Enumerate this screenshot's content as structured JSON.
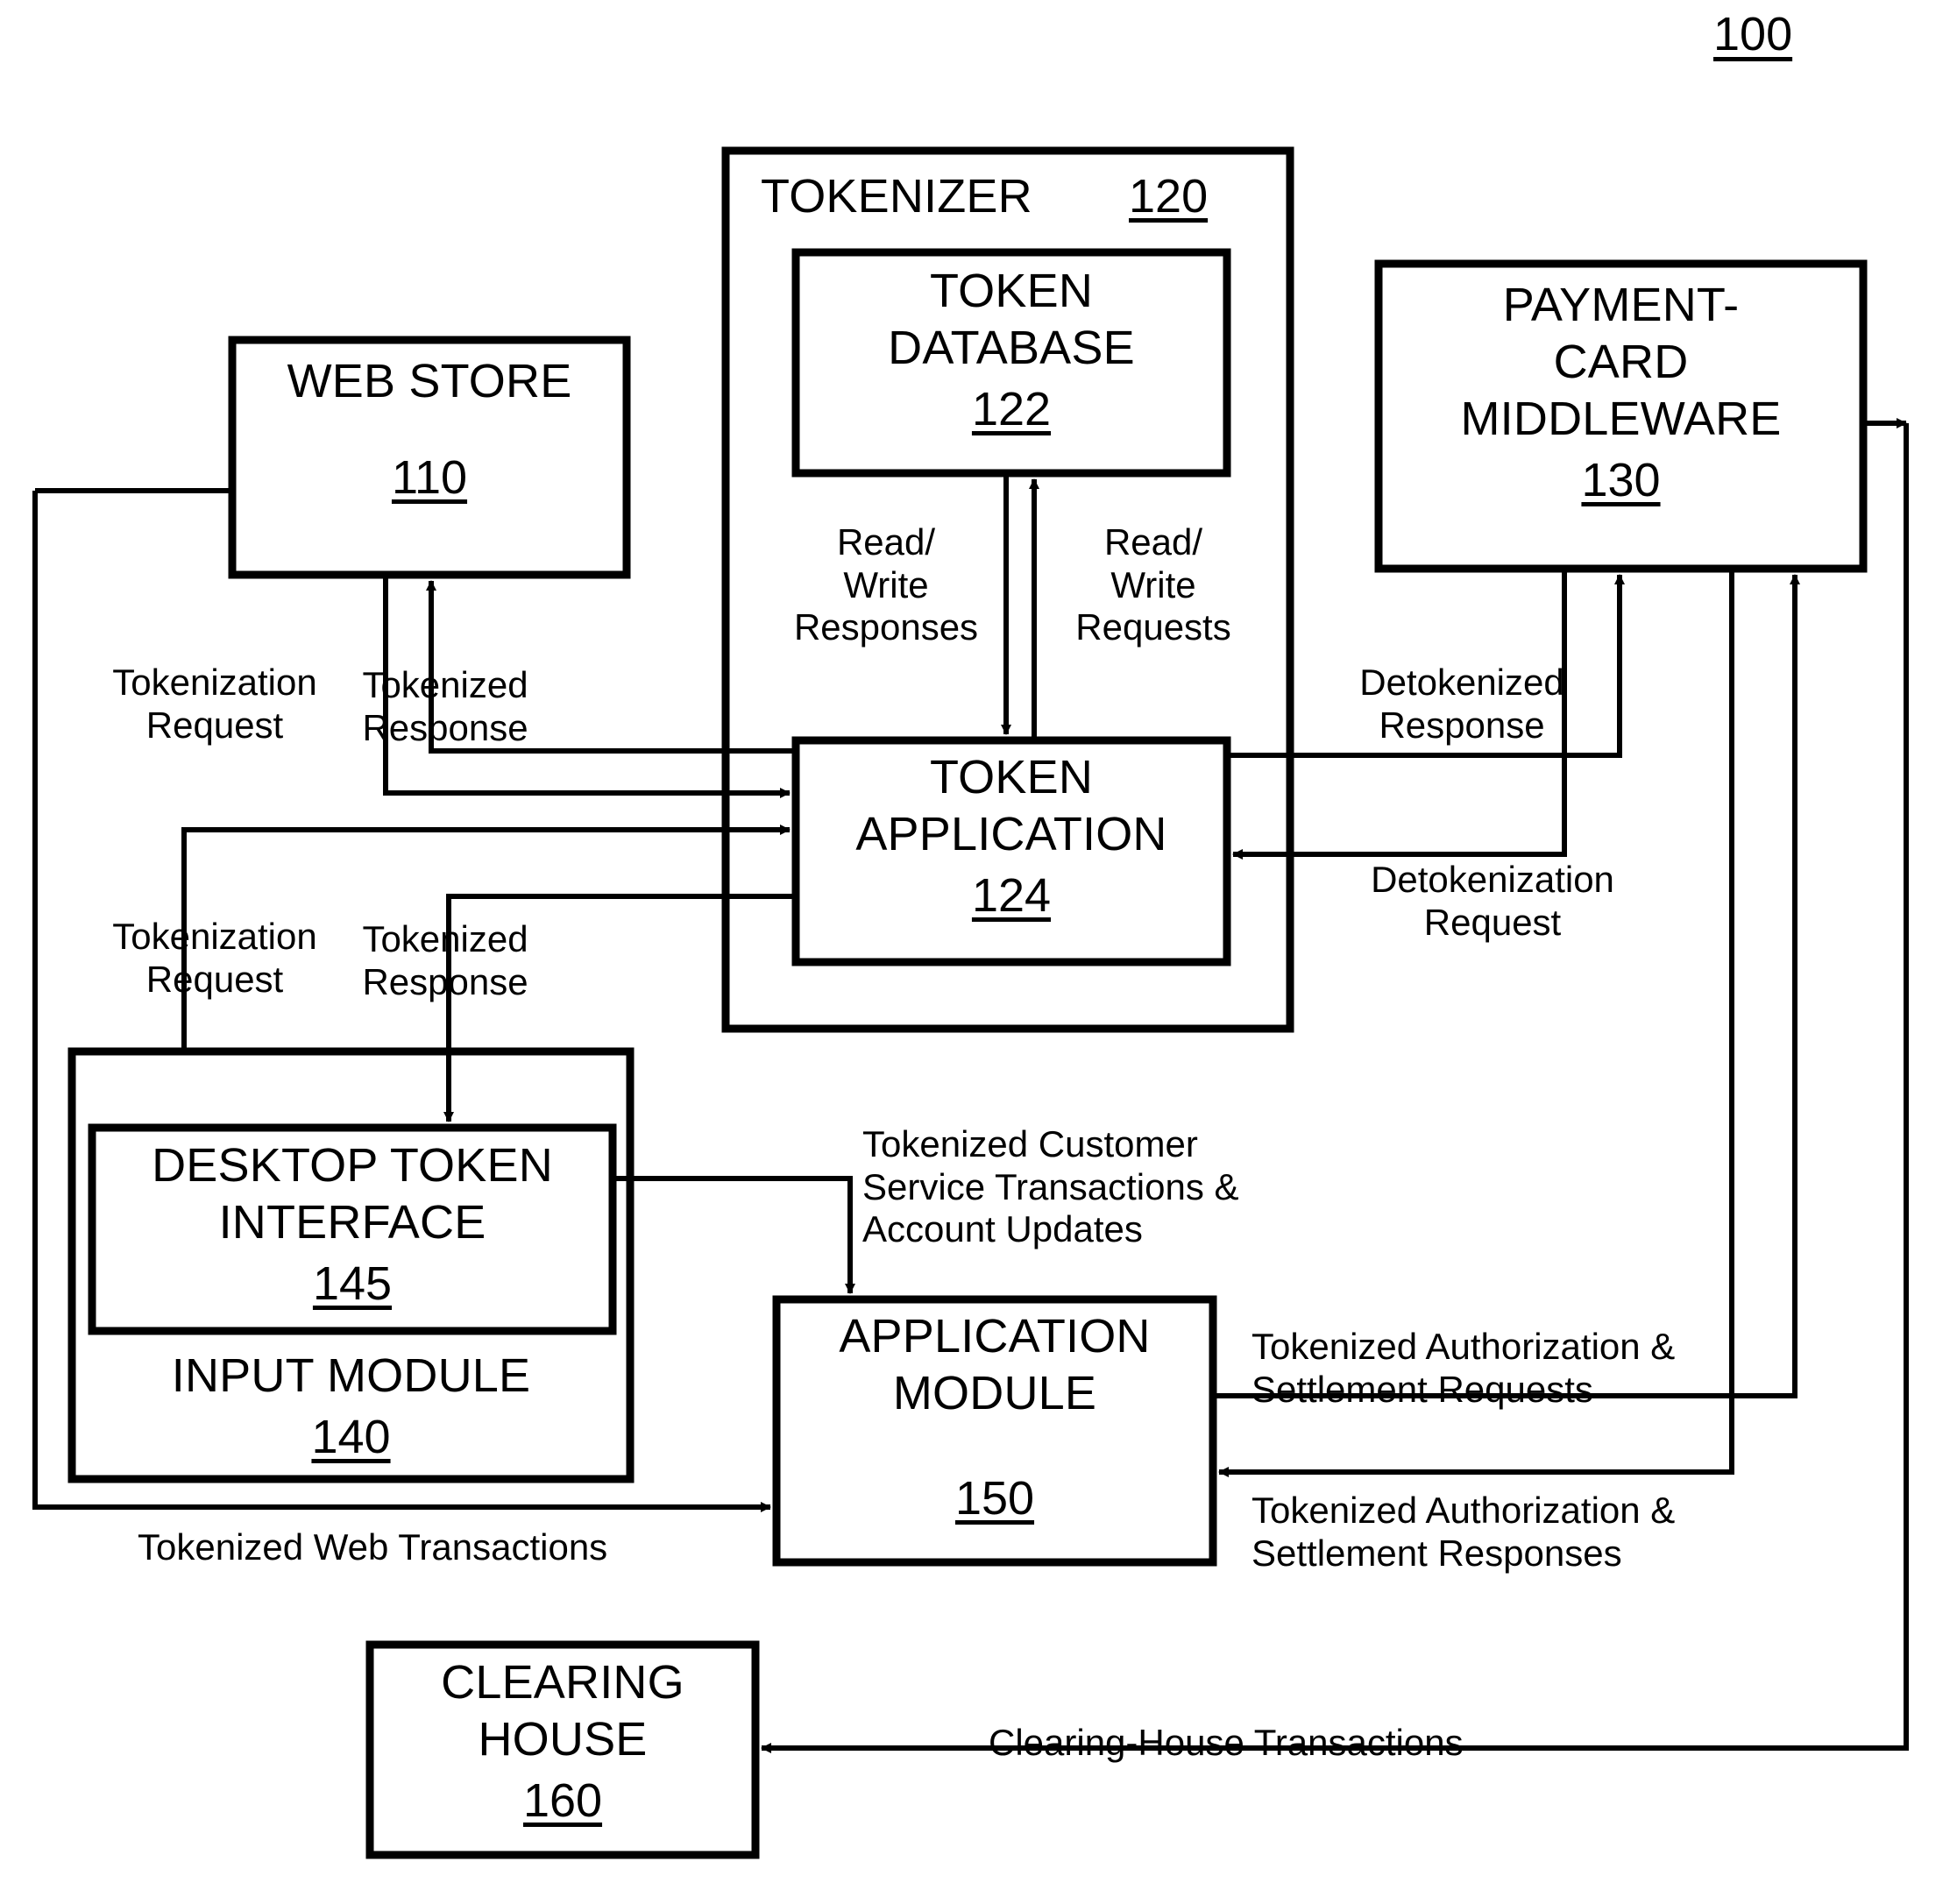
{
  "figure": {
    "number": "100"
  },
  "blocks": {
    "web_store": {
      "title": "WEB STORE",
      "ref": "110"
    },
    "tokenizer": {
      "title": "TOKENIZER",
      "ref": "120"
    },
    "token_database": {
      "title_line1": "TOKEN",
      "title_line2": "DATABASE",
      "ref": "122"
    },
    "token_application": {
      "title_line1": "TOKEN",
      "title_line2": "APPLICATION",
      "ref": "124"
    },
    "payment_middleware": {
      "title_line1": "PAYMENT-",
      "title_line2": "CARD",
      "title_line3": "MIDDLEWARE",
      "ref": "130"
    },
    "input_module": {
      "title": "INPUT MODULE",
      "ref": "140"
    },
    "desktop_token_interface": {
      "title_line1": "DESKTOP TOKEN",
      "title_line2": "INTERFACE",
      "ref": "145"
    },
    "application_module": {
      "title_line1": "APPLICATION",
      "title_line2": "MODULE",
      "ref": "150"
    },
    "clearing_house": {
      "title_line1": "CLEARING",
      "title_line2": "HOUSE",
      "ref": "160"
    }
  },
  "flows": {
    "web_tokenization_request": "Tokenization\nRequest",
    "web_tokenized_response": "Tokenized\nResponse",
    "read_write_responses": "Read/\nWrite\nResponses",
    "read_write_requests": "Read/\nWrite\nRequests",
    "detokenized_response": "Detokenized\nResponse",
    "detokenization_request": "Detokenization\nRequest",
    "input_tokenization_request": "Tokenization\nRequest",
    "input_tokenized_response": "Tokenized\nResponse",
    "tokenized_customer_service": "Tokenized Customer\nService Transactions &\nAccount Updates",
    "tokenized_auth_requests": "Tokenized Authorization &\nSettlement Requests",
    "tokenized_auth_responses": "Tokenized Authorization &\nSettlement Responses",
    "tokenized_web_transactions": "Tokenized Web Transactions",
    "clearing_house_transactions": "Clearing-House Transactions"
  },
  "style": {
    "stroke": "#000000",
    "background": "#ffffff"
  }
}
